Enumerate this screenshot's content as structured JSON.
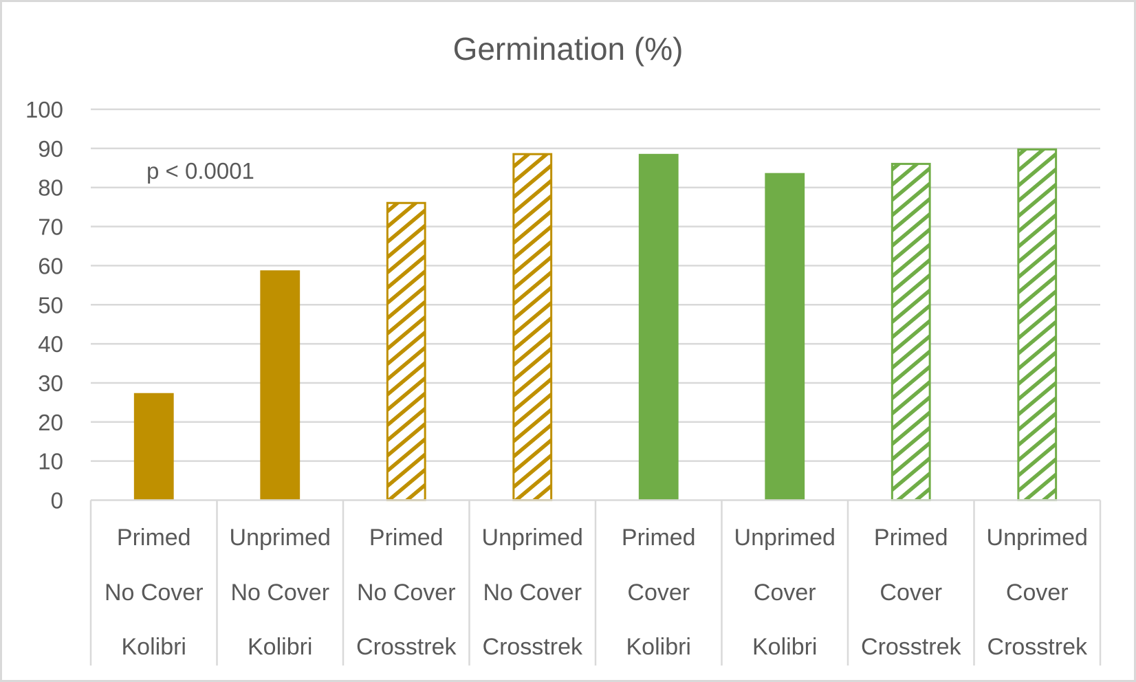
{
  "chart_data": {
    "type": "bar",
    "title": "Germination (%)",
    "xlabel": "",
    "ylabel": "",
    "ylim": [
      0,
      100
    ],
    "yticks": [
      0,
      10,
      20,
      30,
      40,
      50,
      60,
      70,
      80,
      90,
      100
    ],
    "grid": true,
    "legend": "none",
    "annotation": "p < 0.0001",
    "categories": [
      [
        "Primed",
        "No Cover",
        "Kolibri"
      ],
      [
        "Unprimed",
        "No Cover",
        "Kolibri"
      ],
      [
        "Primed",
        "No Cover",
        "Crosstrek"
      ],
      [
        "Unprimed",
        "No Cover",
        "Crosstrek"
      ],
      [
        "Primed",
        "Cover",
        "Kolibri"
      ],
      [
        "Unprimed",
        "Cover",
        "Kolibri"
      ],
      [
        "Primed",
        "Cover",
        "Crosstrek"
      ],
      [
        "Unprimed",
        "Cover",
        "Crosstrek"
      ]
    ],
    "values": [
      27.4,
      58.8,
      76.3,
      88.8,
      88.6,
      83.7,
      86.3,
      90.0
    ],
    "bar_styles": [
      {
        "color": "#BF9000",
        "fill": "solid"
      },
      {
        "color": "#BF9000",
        "fill": "solid"
      },
      {
        "color": "#BF9000",
        "fill": "hatched"
      },
      {
        "color": "#BF9000",
        "fill": "hatched"
      },
      {
        "color": "#70AD47",
        "fill": "solid"
      },
      {
        "color": "#70AD47",
        "fill": "solid"
      },
      {
        "color": "#70AD47",
        "fill": "hatched"
      },
      {
        "color": "#70AD47",
        "fill": "hatched"
      }
    ]
  }
}
